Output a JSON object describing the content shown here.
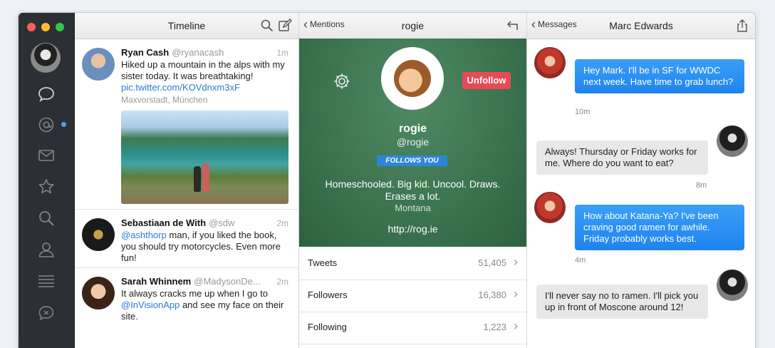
{
  "timeline": {
    "title": "Timeline",
    "tweets": [
      {
        "name": "Ryan Cash",
        "handle": "@ryanacash",
        "time": "1m",
        "text": "Hiked up a mountain in the alps with my sister today. It was breathtaking!",
        "link": "pic.twitter.com/KOVdnxm3xF",
        "location": "Maxvorstadt, München"
      },
      {
        "name": "Sebastiaan de With",
        "handle": "@sdw",
        "time": "2m",
        "mention": "@ashthorp",
        "text": " man, if you liked the book, you should try motorcycles. Even more fun!"
      },
      {
        "name": "Sarah Whinnem",
        "handle": "@MadysonDe...",
        "time": "2m",
        "text_before": "It always cracks me up when I go to ",
        "mention": "@InVisionApp",
        "text_after": " and see my face on their site."
      }
    ]
  },
  "profile": {
    "back_label": "Mentions",
    "title": "rogie",
    "name": "rogie",
    "handle": "@rogie",
    "unfollow_label": "Unfollow",
    "follows_badge": "FOLLOWS YOU",
    "bio": "Homeschooled. Big kid. Uncool. Draws. Erases a lot.",
    "location": "Montana",
    "url": "http://rog.ie",
    "stats": [
      {
        "label": "Tweets",
        "value": "51,405"
      },
      {
        "label": "Followers",
        "value": "16,380"
      },
      {
        "label": "Following",
        "value": "1,223"
      }
    ]
  },
  "messages": {
    "back_label": "Messages",
    "title": "Marc Edwards",
    "items": [
      {
        "from": "them",
        "text": "Hey Mark. I'll be in SF for WWDC next week. Have time to grab lunch?",
        "time": "10m"
      },
      {
        "from": "me",
        "text": "Always! Thursday or Friday works for me. Where do you want to eat?",
        "time": "8m"
      },
      {
        "from": "them",
        "text": "How about Katana-Ya? I've been craving good ramen for awhile. Friday probably works best.",
        "time": "4m"
      },
      {
        "from": "me",
        "text": "I'll never say no to ramen. I'll pick you up in front of Moscone around 12!"
      }
    ]
  },
  "colors": {
    "accent": "#1f83ef",
    "unfollow": "#e84a55",
    "link": "#2a7bd6",
    "sidebar": "#2c3035"
  }
}
